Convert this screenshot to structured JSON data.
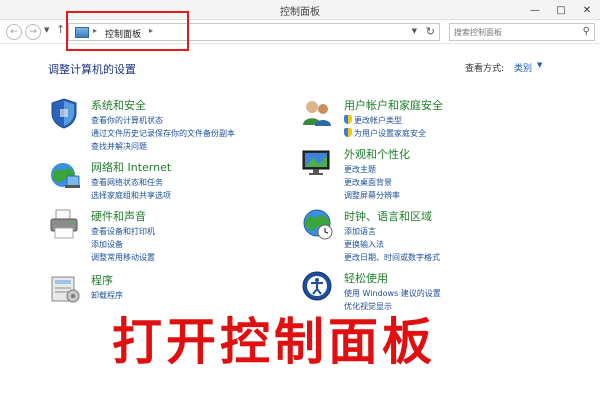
{
  "window": {
    "title": "控制面板"
  },
  "navigation": {
    "breadcrumb": "控制面板",
    "search_placeholder": "搜索控制面板"
  },
  "content": {
    "heading": "调整计算机的设置",
    "view_by_label": "查看方式:",
    "view_by_value": "类别"
  },
  "categories": [
    {
      "icon": "shield-flag-icon",
      "title": "系统和安全",
      "links": [
        "查看你的计算机状态",
        "通过文件历史记录保存你的文件备份副本",
        "查找并解决问题"
      ]
    },
    {
      "icon": "network-icon",
      "title": "网络和 Internet",
      "links": [
        "查看网络状态和任务",
        "选择家庭组和共享选项"
      ]
    },
    {
      "icon": "printer-icon",
      "title": "硬件和声音",
      "links": [
        "查看设备和打印机",
        "添加设备",
        "调整常用移动设置"
      ]
    },
    {
      "icon": "programs-icon",
      "title": "程序",
      "links": [
        "卸载程序"
      ]
    },
    {
      "icon": "users-icon",
      "title": "用户帐户和家庭安全",
      "links": [
        "更改帐户类型",
        "为用户设置家庭安全"
      ]
    },
    {
      "icon": "display-icon",
      "title": "外观和个性化",
      "links": [
        "更改主题",
        "更改桌面背景",
        "调整屏幕分辨率"
      ]
    },
    {
      "icon": "globe-clock-icon",
      "title": "时钟、语言和区域",
      "links": [
        "添加语言",
        "更换输入法",
        "更改日期、时间或数字格式"
      ]
    },
    {
      "icon": "accessibility-icon",
      "title": "轻松使用",
      "links": [
        "使用 Windows 建议的设置",
        "优化视觉显示"
      ]
    }
  ],
  "overlay_caption": "打开控制面板"
}
